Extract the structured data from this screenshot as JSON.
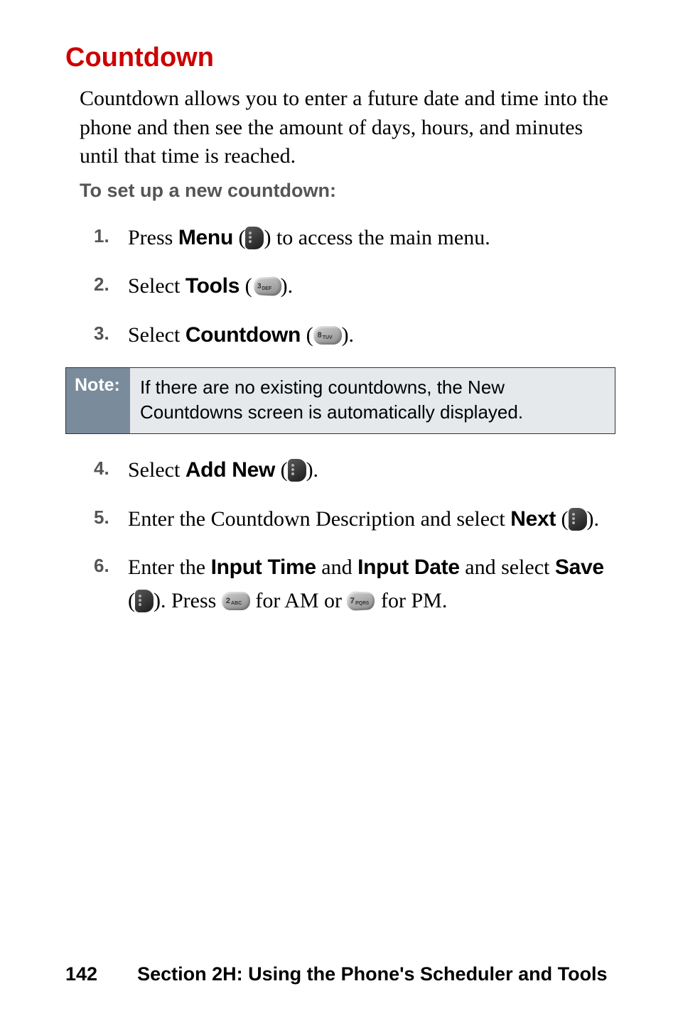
{
  "heading": "Countdown",
  "intro": "Countdown allows you to enter a future date and time into the phone and then see the amount of days, hours, and minutes until that time is reached.",
  "subhead": "To set up a new countdown:",
  "steps": {
    "s1": {
      "a": "Press ",
      "b": "Menu",
      "c": " (",
      "d": ") to access the main menu."
    },
    "s2": {
      "a": "Select ",
      "b": "Tools",
      "c": " (",
      "d": ")."
    },
    "s3": {
      "a": "Select ",
      "b": "Countdown",
      "c": " (",
      "d": ")."
    },
    "s4": {
      "a": "Select ",
      "b": "Add New",
      "c": " (",
      "d": ")."
    },
    "s5": {
      "a": "Enter the Countdown Description and select ",
      "b": "Next",
      "c": " (",
      "d": ")."
    },
    "s6": {
      "a": "Enter the ",
      "b": "Input Time",
      "c": " and ",
      "d": "Input Date",
      "e": " and select ",
      "f": "Save",
      "g": " (",
      "h": ").  Press ",
      "i": " for AM or ",
      "j": " for PM."
    }
  },
  "note": {
    "label": "Note:",
    "text": "If there are no existing countdowns, the New Countdowns screen is automatically displayed."
  },
  "footer": {
    "page": "142",
    "section": "Section 2H: Using the Phone's Scheduler and Tools"
  },
  "keys": {
    "three": "3",
    "three_sup": "DEF",
    "eight": "8",
    "eight_sup": "TUV",
    "two": "2",
    "two_sup": "ABC",
    "seven": "7",
    "seven_sup": "PQRS"
  }
}
